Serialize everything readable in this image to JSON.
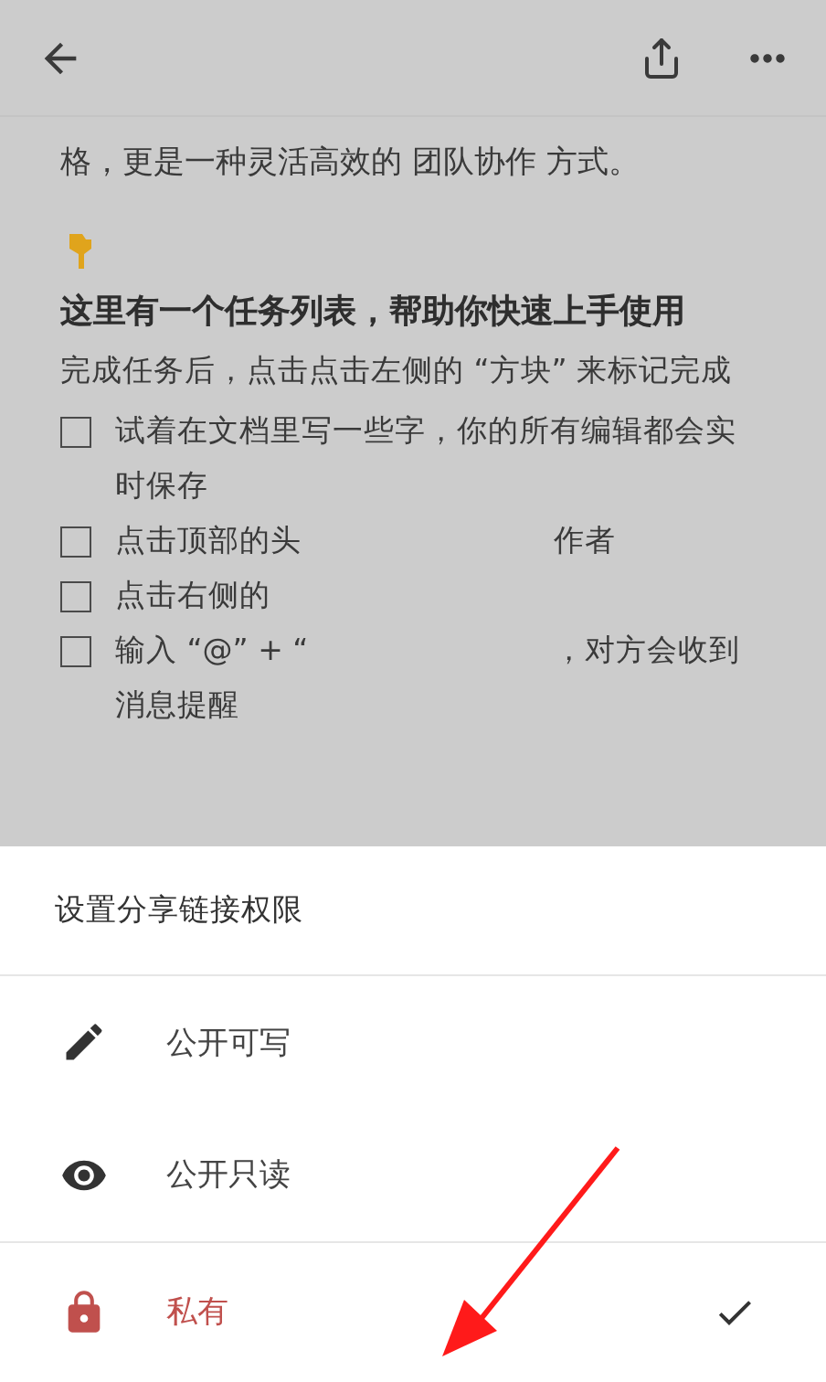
{
  "document": {
    "intro_line": "格，更是一种灵活高效的 团队协作 方式。",
    "heading": "这里有一个任务列表，帮助你快速上手使用",
    "paragraph": "完成任务后，点击点击左侧的 “方块” 来标记完成",
    "tasks": [
      {
        "text": "试着在文档里写一些字，你的所有编辑都会实时保存",
        "checked": false
      },
      {
        "text": "点击顶部的头",
        "tail": "作者",
        "checked": false
      },
      {
        "text": "点击右侧的",
        "checked": false
      },
      {
        "text": "输入 “@” + “",
        "tail": "，对方会收到",
        "continued": "消息提醒",
        "checked": false
      }
    ]
  },
  "share_sheet": {
    "title": "设置分享链接权限",
    "options": [
      {
        "label": "公开可写",
        "selected": false
      },
      {
        "label": "公开只读",
        "selected": false
      },
      {
        "label": "私有",
        "selected": true
      }
    ]
  }
}
